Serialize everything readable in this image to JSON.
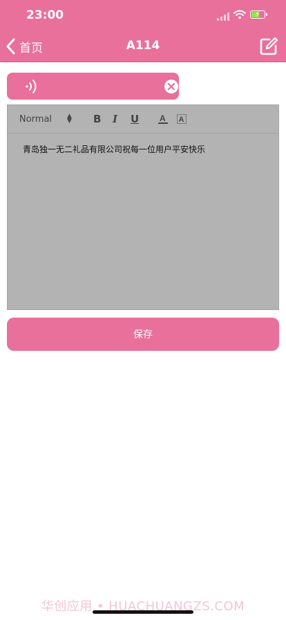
{
  "status_bar": {
    "time": "23:00"
  },
  "header": {
    "back_label": "首页",
    "title": "A114"
  },
  "editor": {
    "font_size_option": "Normal",
    "toolbar_buttons": {
      "bold": "B",
      "italic": "I",
      "underline": "U",
      "text_color": "A",
      "background_color": "A"
    },
    "content": "青岛独一无二礼品有限公司祝每一位用户平安快乐"
  },
  "save_label": "保存",
  "watermark": "华创应用 • HUACHUANGZS.COM",
  "colors": {
    "accent": "#e8709b",
    "editor_bg": "#b3b3b3"
  }
}
